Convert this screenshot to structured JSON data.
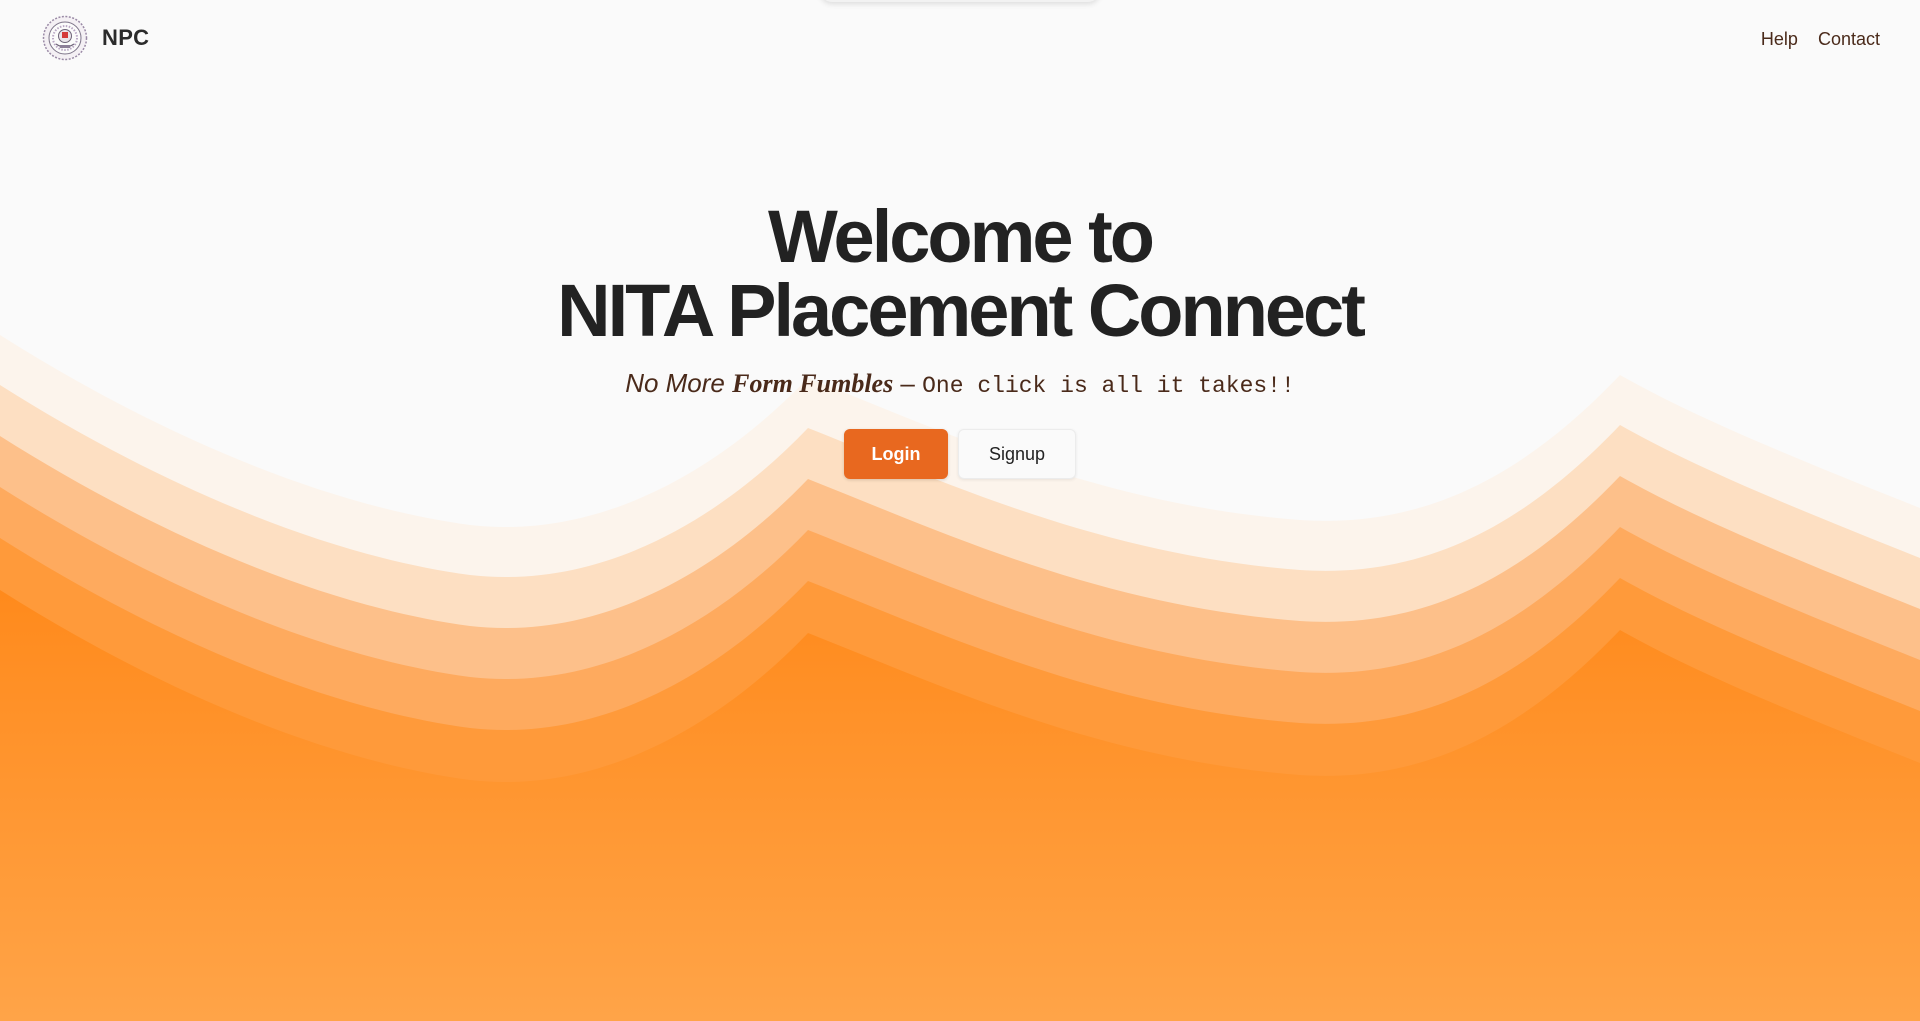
{
  "navbar": {
    "brand": "NPC",
    "links": [
      {
        "label": "Help"
      },
      {
        "label": "Contact"
      }
    ]
  },
  "hero": {
    "title_line1": "Welcome to",
    "title_line2": "NITA Placement Connect",
    "subtitle": {
      "part1": "No More ",
      "part2": "Form Fumbles",
      "part3": " – ",
      "part4": "One click is all it takes!!"
    },
    "login_label": "Login",
    "signup_label": "Signup"
  },
  "colors": {
    "accent": "#e8681f",
    "wave_light": "#fdf3ea",
    "wave_mid": "#fbb478",
    "wave_deep": "#ff8f24",
    "text_dark": "#222222",
    "text_brown": "#4a2a1a"
  },
  "icons": {
    "logo": "institute-emblem-icon"
  }
}
